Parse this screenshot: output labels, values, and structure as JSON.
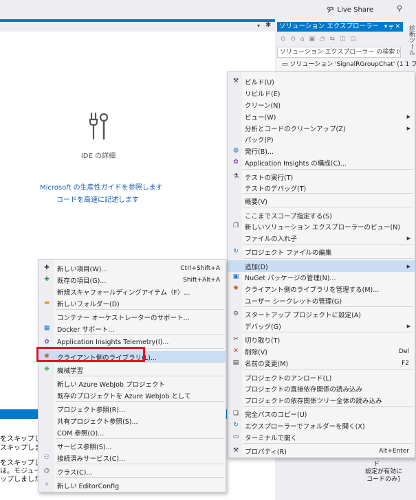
{
  "topbar": {
    "live_share": "Live Share",
    "live_share_icon": "live-share-icon",
    "pin_icon": "pin-icon"
  },
  "editor": {
    "ide_label": "IDE の詳細",
    "link1": "Microsoft の生産性ガイドを参照します",
    "link2": "コードを高速に記述します"
  },
  "output": {
    "lines": [
      "をスキップし",
      "スキップしまし",
      "をスキップし",
      "ほ。モジュール",
      "ップしました。"
    ]
  },
  "solution_explorer": {
    "title": "ソリューション エクスプローラー",
    "title_buttons": "▾ ╤ ✕",
    "toolbar_icons": "⊙ ⊙ ⌂ ▣ ◷ ⇆ ◫ ◫",
    "search_placeholder": "ソリューション エクスプローラー の検索 (Ctrl",
    "solution_item": "ソリューション 'SignalRGroupChat' (1/1 プ",
    "project_item": "SignalRGroupChat",
    "vertical_tab": "診断ツール",
    "bottom_text": [
      "マイ コード",
      "設定が有効に",
      "コードのみ]"
    ]
  },
  "main_menu": {
    "items": [
      {
        "label": "ビルド(U)",
        "icon": "build-icon"
      },
      {
        "label": "リビルド(E)"
      },
      {
        "label": "クリーン(N)"
      },
      {
        "label": "ビュー(W)",
        "submenu": true
      },
      {
        "label": "分析とコードのクリーンアップ(Z)",
        "submenu": true
      },
      {
        "label": "パック(P)"
      },
      {
        "label": "発行(B)...",
        "icon": "publish-icon"
      },
      {
        "label": "Application Insights の構成(C)...",
        "icon": "insights-icon"
      },
      {
        "label": "テストの実行(T)",
        "icon": "test-icon"
      },
      {
        "label": "テストのデバッグ(T)"
      },
      {
        "label": "概要(V)"
      },
      {
        "label": "ここまでスコープ指定する(S)"
      },
      {
        "label": "新しいソリューション エクスプローラーのビュー(N)",
        "icon": "new-view-icon"
      },
      {
        "label": "ファイルの入れ子",
        "submenu": true
      },
      {
        "label": "プロジェクト ファイルの編集",
        "icon": "edit-project-icon"
      },
      {
        "label": "追加(D)",
        "submenu": true
      },
      {
        "label": "NuGet パッケージの管理(N)...",
        "icon": "nuget-icon"
      },
      {
        "label": "クライアント側のライブラリを管理する(M)...",
        "icon": "libman-icon"
      },
      {
        "label": "ユーザー シークレットの管理(G)"
      },
      {
        "label": "スタートアップ プロジェクトに設定(A)",
        "icon": "gear-icon"
      },
      {
        "label": "デバッグ(G)",
        "submenu": true
      },
      {
        "label": "切り取り(T)",
        "icon": "cut-icon"
      },
      {
        "label": "削除(V)",
        "icon": "delete-icon",
        "shortcut": "Del"
      },
      {
        "label": "名前の変更(M)",
        "icon": "rename-icon",
        "shortcut": "F2"
      },
      {
        "label": "プロジェクトのアンロード(L)"
      },
      {
        "label": "プロジェクトの直接依存関係の読み込み"
      },
      {
        "label": "プロジェクトの依存関係ツリー全体の読み込み"
      },
      {
        "label": "完全パスのコピー(U)",
        "icon": "copy-icon"
      },
      {
        "label": "エクスプローラーでフォルダーを開く(X)",
        "icon": "open-folder-icon"
      },
      {
        "label": "ターミナルで開く",
        "icon": "terminal-icon"
      },
      {
        "label": "プロパティ(R)",
        "icon": "wrench-icon",
        "shortcut": "Alt+Enter"
      }
    ]
  },
  "add_menu": {
    "items": [
      {
        "label": "新しい項目(W)...",
        "icon": "new-item-icon",
        "shortcut": "Ctrl+Shift+A"
      },
      {
        "label": "既存の項目(G)...",
        "icon": "existing-item-icon",
        "shortcut": "Shift+Alt+A"
      },
      {
        "label": "新規スキャフォールディングアイテム（F）..."
      },
      {
        "label": "新しいフォルダー(D)",
        "icon": "new-folder-icon"
      },
      {
        "label": "コンテナー オーケストレーターのサポート..."
      },
      {
        "label": "Docker サポート...",
        "icon": "docker-icon"
      },
      {
        "label": "Application Insights Telemetry(I)...",
        "icon": "telemetry-icon"
      },
      {
        "label": "クライアント側のライブラリ(L)...",
        "icon": "client-library-icon"
      },
      {
        "label": "機械学習",
        "icon": "ml-icon"
      },
      {
        "label": "新しい Azure WebJob プロジェクト"
      },
      {
        "label": "既存のプロジェクトを Azure WebJob として"
      },
      {
        "label": "プロジェクト参照(R)..."
      },
      {
        "label": "共有プロジェクト参照(S)..."
      },
      {
        "label": "COM 参照(O)..."
      },
      {
        "label": "サービス参照(S)..."
      },
      {
        "label": "接続済みサービス(C)...",
        "icon": "connected-service-icon"
      },
      {
        "label": "クラス(C)...",
        "icon": "class-icon"
      },
      {
        "label": "新しい EditorConfig",
        "icon": "editorconfig-icon"
      }
    ]
  }
}
